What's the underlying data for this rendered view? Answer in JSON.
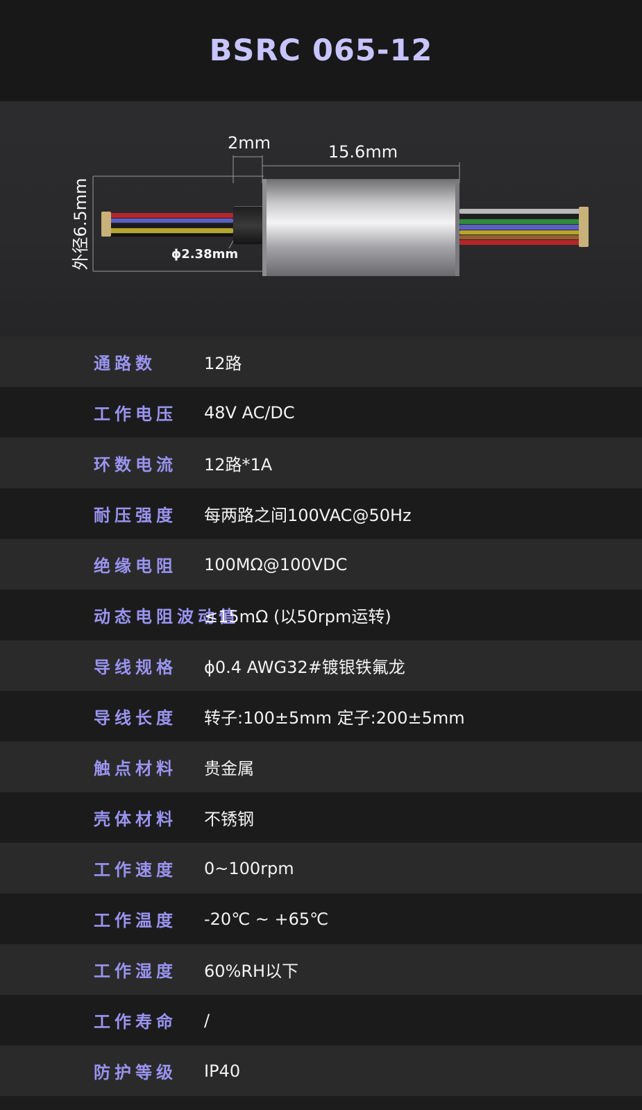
{
  "product": {
    "title": "BSRC 065-12"
  },
  "drawing": {
    "dim_shoulder": "2mm",
    "dim_body_length": "15.6mm",
    "dim_outer_diameter": "外径6.5mm",
    "dim_shaft_diameter": "ϕ2.38mm",
    "colors": {
      "body_light": "#e6e6e6",
      "body_dark": "#8a8a8a",
      "wire_red": "#b3262b",
      "wire_blue": "#5b5fc4",
      "wire_yellow": "#b5a530",
      "wire_green": "#2f8a3a",
      "wire_gray": "#b9b9b9",
      "wire_black": "#1a1a1a",
      "terminal": "#c9b27a"
    }
  },
  "specs": [
    {
      "label": "通路数",
      "value": "12路"
    },
    {
      "label": "工作电压",
      "value": "48V AC/DC"
    },
    {
      "label": "环数电流",
      "value": "12路*1A"
    },
    {
      "label": "耐压强度",
      "value": "每两路之间100VAC@50Hz"
    },
    {
      "label": "绝缘电阻",
      "value": "100MΩ@100VDC"
    },
    {
      "label": "动态电阻波动值",
      "value": "≤15mΩ (以50rpm运转)"
    },
    {
      "label": "导线规格",
      "value": "ϕ0.4 AWG32#镀银铁氟龙"
    },
    {
      "label": "导线长度",
      "value": "转子:100±5mm  定子:200±5mm"
    },
    {
      "label": "触点材料",
      "value": "贵金属"
    },
    {
      "label": "壳体材料",
      "value": "不锈钢"
    },
    {
      "label": "工作速度",
      "value": "0~100rpm"
    },
    {
      "label": "工作温度",
      "value": "-20℃ ~ +65℃"
    },
    {
      "label": "工作湿度",
      "value": "60%RH以下"
    },
    {
      "label": "工作寿命",
      "value": "/"
    },
    {
      "label": "防护等级",
      "value": "IP40"
    }
  ],
  "theme": {
    "title_color": "#c7c4ff",
    "label_color": "#9a94f0",
    "row_light": "#2a2a2b",
    "row_dark": "#1b1b1c"
  }
}
